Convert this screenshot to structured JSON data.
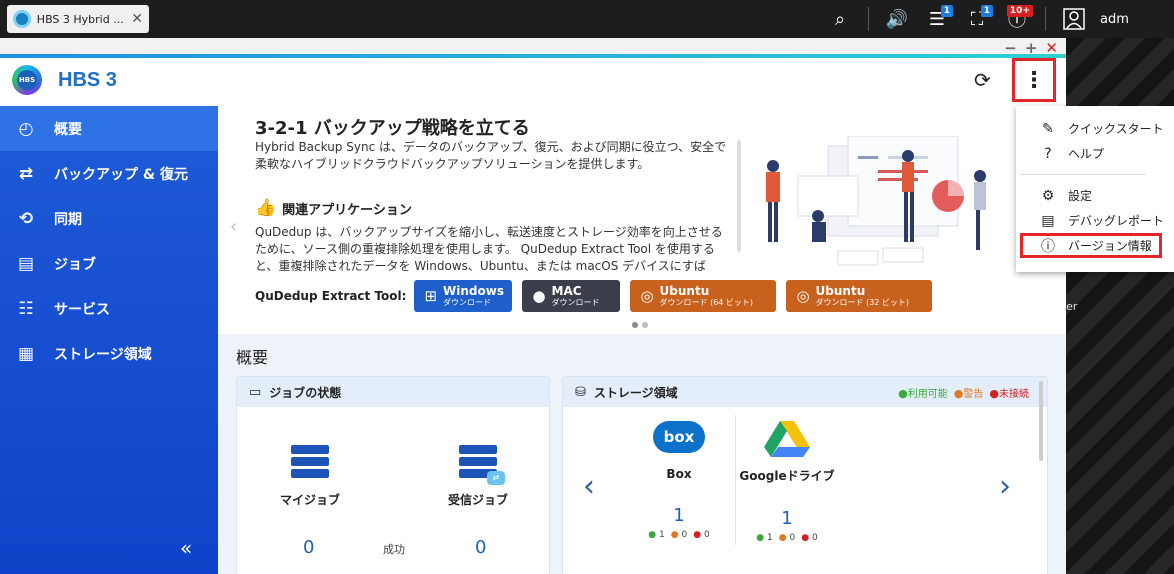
{
  "browser_tab": {
    "title": "HBS 3 Hybrid ...",
    "close": "✕"
  },
  "system_bar": {
    "icons": [
      {
        "name": "search-icon",
        "glyph": "⌕"
      },
      {
        "name": "volume-icon",
        "glyph": "🔊"
      },
      {
        "name": "tasks-icon",
        "glyph": "☰",
        "badge": "1"
      },
      {
        "name": "notification-icon",
        "glyph": "⛶",
        "badge": "1"
      },
      {
        "name": "info-icon",
        "glyph": "ⓘ",
        "badge": "10+"
      }
    ],
    "user": "adm"
  },
  "app": {
    "title": "HBS 3",
    "logo_text": "HBS"
  },
  "sidebar": {
    "items": [
      {
        "label": "概要",
        "icon": "dashboard-icon",
        "glyph": "◴"
      },
      {
        "label": "バックアップ & 復元",
        "icon": "backup-icon",
        "glyph": "⇄"
      },
      {
        "label": "同期",
        "icon": "sync-icon",
        "glyph": "⟲"
      },
      {
        "label": "ジョブ",
        "icon": "job-icon",
        "glyph": "▤"
      },
      {
        "label": "サービス",
        "icon": "service-icon",
        "glyph": "☷"
      },
      {
        "label": "ストレージ領域",
        "icon": "storage-icon",
        "glyph": "▦"
      }
    ],
    "collapse": "«"
  },
  "banner": {
    "title": "3-2-1 バックアップ戦略を立てる",
    "desc": "Hybrid Backup Sync は、データのバックアップ、復元、および同期に役立つ、安全で柔軟なハイブリッドクラウドバックアップソリューションを提供します。",
    "subtitle": "関連アプリケーション",
    "body": "QuDedup は、バックアップサイズを縮小し、転送速度とストレージ効率を向上させるために、ソース側の重複排除処理を使用します。 QuDedup Extract Tool を使用すると、重複排除されたデータを Windows、Ubuntu、または macOS デバイスにすば",
    "tool_label": "QuDedup Extract Tool:",
    "buttons": [
      {
        "title": "Windows",
        "sub": "ダウンロード"
      },
      {
        "title": "MAC",
        "sub": "ダウンロード"
      },
      {
        "title": "Ubuntu",
        "sub": "ダウンロード (64 ビット)"
      },
      {
        "title": "Ubuntu",
        "sub": "ダウンロード (32 ビット)"
      }
    ]
  },
  "summary": {
    "title": "概要",
    "jobs": {
      "title": "ジョブの状態",
      "my_jobs": "マイジョブ",
      "incoming_jobs": "受信ジョブ",
      "my_count": "0",
      "success_label": "成功",
      "incoming_count": "0"
    },
    "storage": {
      "title": "ストレージ領域",
      "legend": [
        {
          "label": "利用可能",
          "color": "#3aa83a"
        },
        {
          "label": "警告",
          "color": "#e07a1e"
        },
        {
          "label": "未接続",
          "color": "#d02020"
        }
      ],
      "items": [
        {
          "name": "Box",
          "logo": "box",
          "count": "1",
          "stats": [
            "1",
            "0",
            "0"
          ]
        },
        {
          "name": "Googleドライブ",
          "count": "1",
          "stats": [
            "1",
            "0",
            "0"
          ]
        }
      ]
    }
  },
  "menu": {
    "items": [
      {
        "label": "クイックスタート",
        "glyph": "✎"
      },
      {
        "label": "ヘルプ",
        "glyph": "?"
      },
      {
        "label": "設定",
        "glyph": "⚙"
      },
      {
        "label": "デバッグレポート",
        "glyph": "▤"
      },
      {
        "label": "バージョン情報",
        "glyph": "ⓘ"
      }
    ]
  },
  "background_text": "er"
}
